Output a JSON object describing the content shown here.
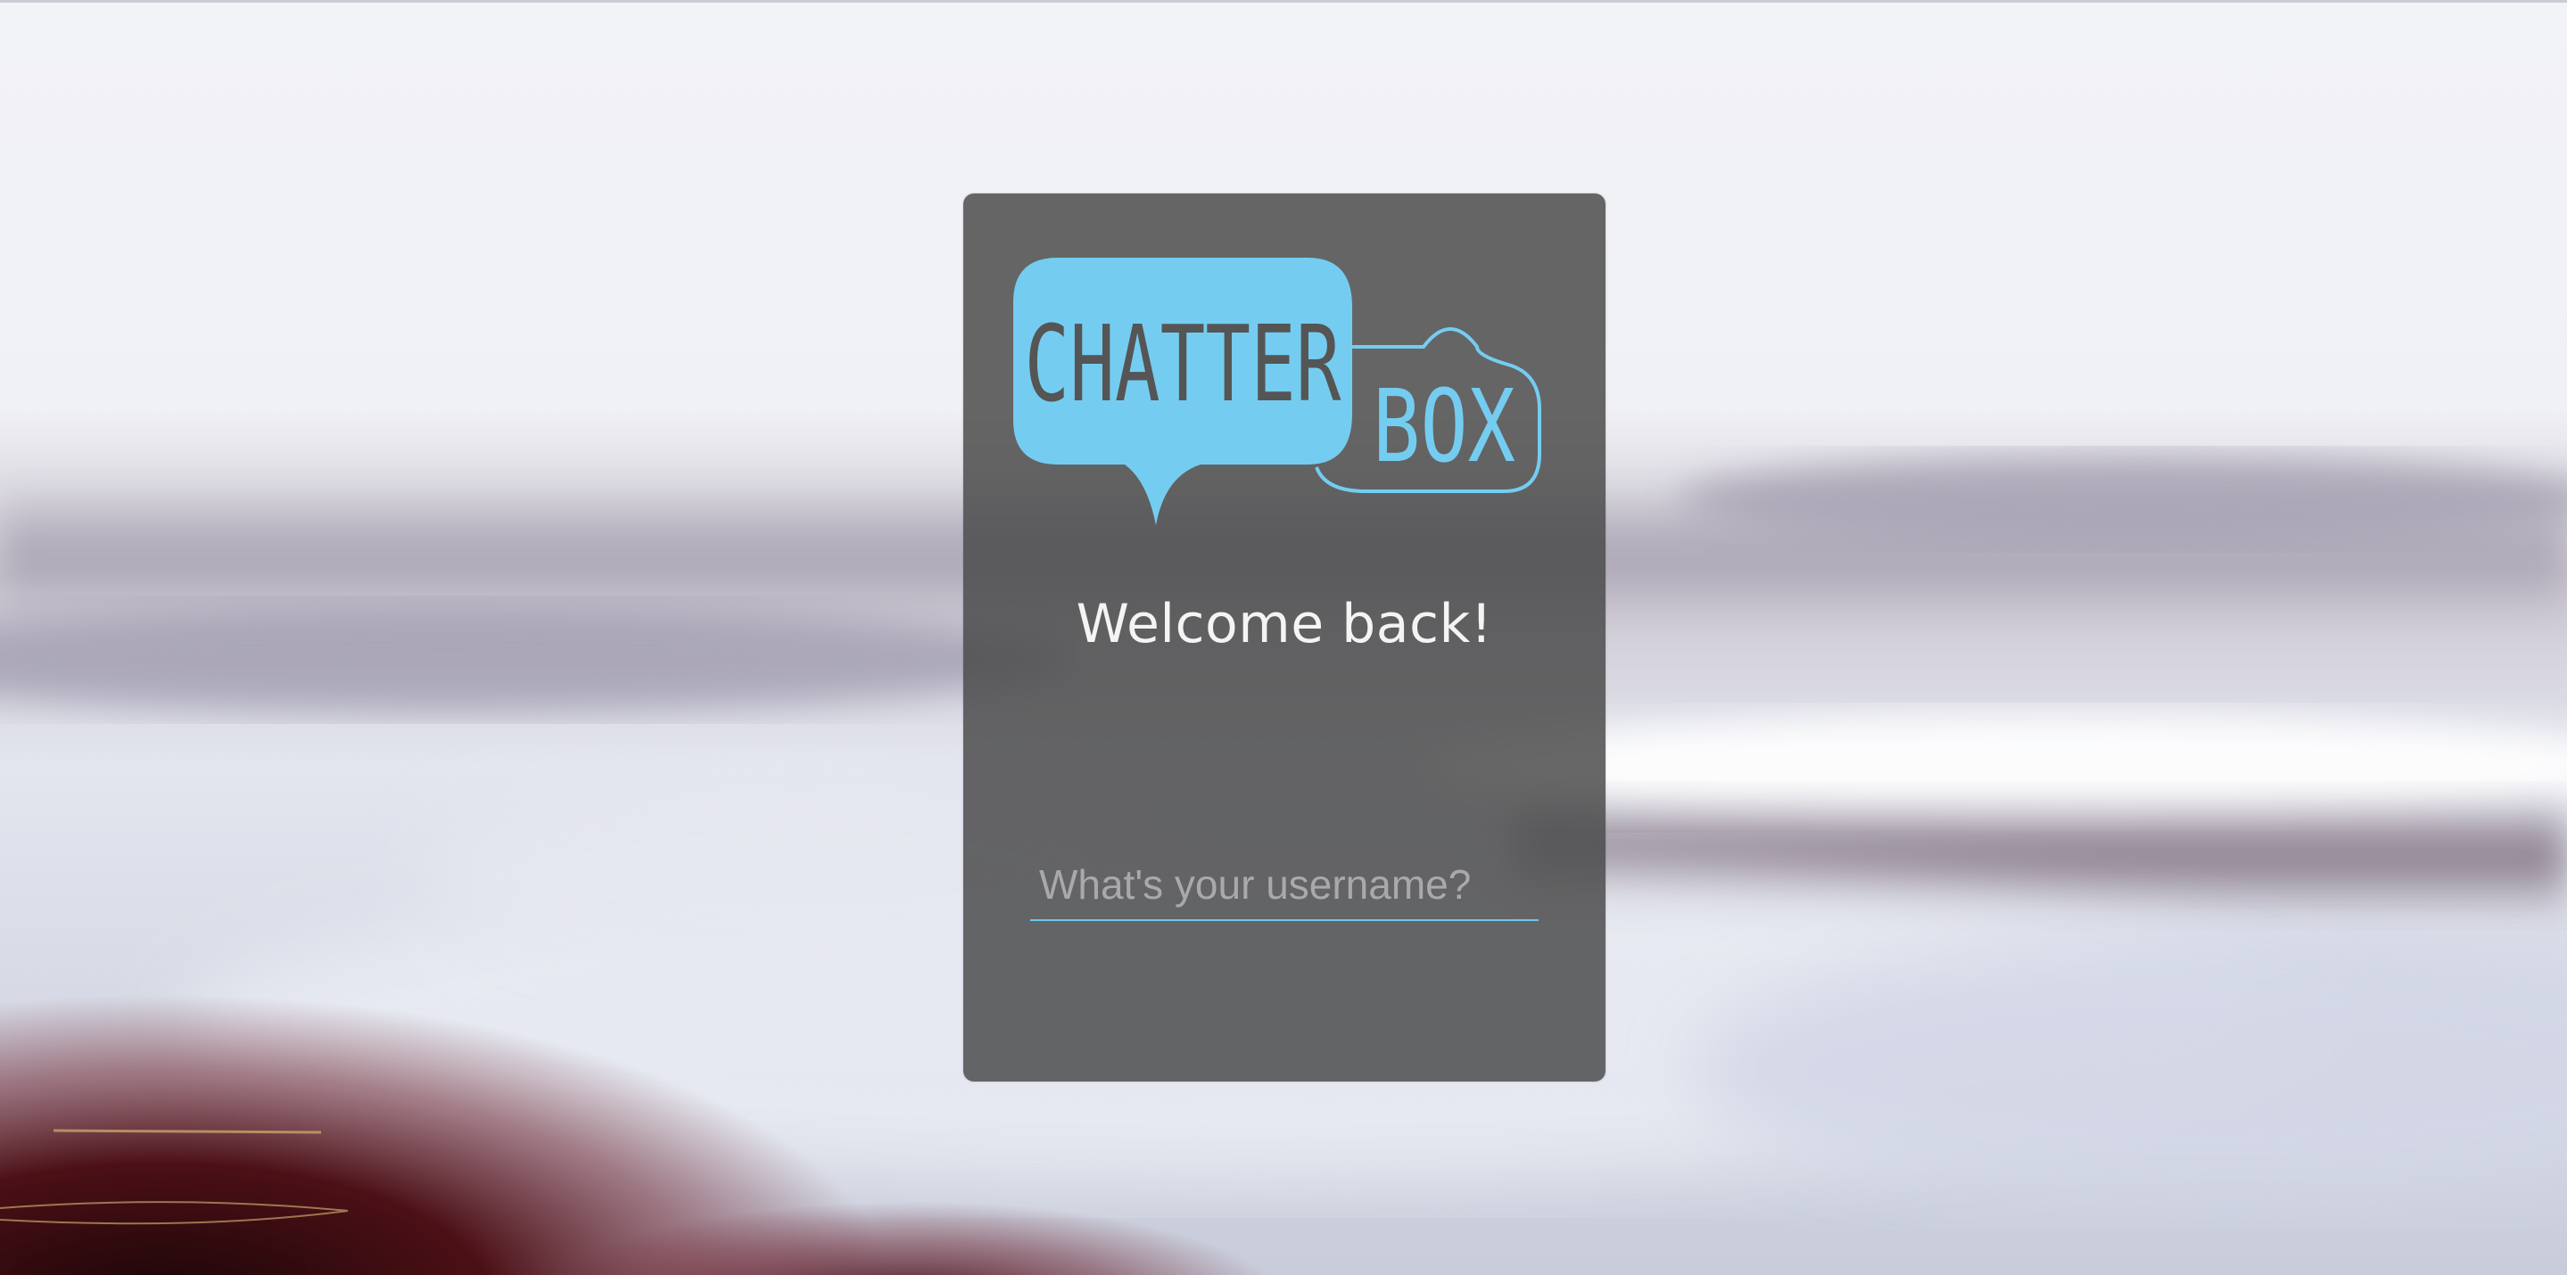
{
  "logo": {
    "word1": "CHATTER",
    "word2": "BOX",
    "accent_color": "#74cdf0",
    "text_color": "#555555"
  },
  "card": {
    "heading": "Welcome back!"
  },
  "login": {
    "username_value": "",
    "username_placeholder": "What's your username?"
  },
  "colors": {
    "card_bg": "rgba(74,74,74,0.84)",
    "input_underline": "#6cc7ee"
  }
}
